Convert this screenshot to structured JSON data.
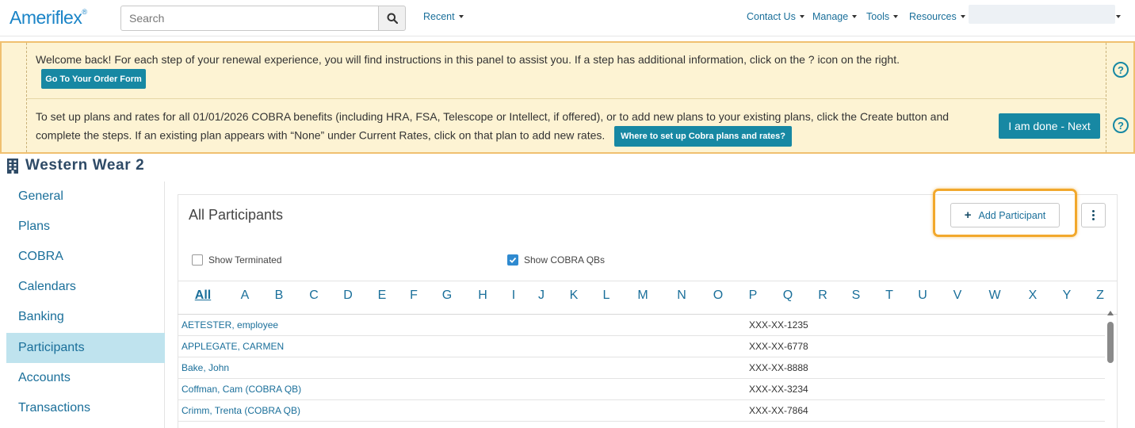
{
  "topnav": {
    "logo": "Ameriflex",
    "logo_mark": "®",
    "search_placeholder": "Search",
    "recent": "Recent",
    "contact_us": "Contact Us",
    "manage": "Manage",
    "tools": "Tools",
    "resources": "Resources"
  },
  "banner": {
    "welcome": "Welcome back! For each step of your renewal experience, you will find instructions in this panel to assist you. If a step has additional information, click on the ? icon on the right.",
    "order_button": "Go To Your Order Form",
    "instructions": "To set up plans and rates for all 01/01/2026 COBRA benefits (including HRA, FSA, Telescope or Intellect, if offered), or to add new plans to your existing plans, click the Create button and complete the steps. If an existing plan appears with “None” under Current Rates, click on that plan to add new rates.",
    "cobra_button": "Where to set up Cobra plans and rates?",
    "done_button": "I am done - Next",
    "help_glyph": "?"
  },
  "company": {
    "name": "Western Wear 2"
  },
  "sidebar": {
    "items": [
      {
        "label": "General"
      },
      {
        "label": "Plans"
      },
      {
        "label": "COBRA"
      },
      {
        "label": "Calendars"
      },
      {
        "label": "Banking"
      },
      {
        "label": "Participants",
        "active": true
      },
      {
        "label": "Accounts"
      },
      {
        "label": "Transactions"
      }
    ]
  },
  "main": {
    "title": "All Participants",
    "add_button": "Add Participant",
    "add_icon": "+",
    "show_terminated": "Show Terminated",
    "show_terminated_checked": false,
    "show_cobra": "Show COBRA QBs",
    "show_cobra_checked": true,
    "alphabet": [
      "All",
      "A",
      "B",
      "C",
      "D",
      "E",
      "F",
      "G",
      "H",
      "I",
      "J",
      "K",
      "L",
      "M",
      "N",
      "O",
      "P",
      "Q",
      "R",
      "S",
      "T",
      "U",
      "V",
      "W",
      "X",
      "Y",
      "Z"
    ],
    "selected_letter": "All",
    "rows": [
      {
        "name": "AETESTER, employee",
        "ssn": "XXX-XX-1235"
      },
      {
        "name": "APPLEGATE, CARMEN",
        "ssn": "XXX-XX-6778"
      },
      {
        "name": "Bake, John",
        "ssn": "XXX-XX-8888"
      },
      {
        "name": "Coffman, Cam (COBRA QB)",
        "ssn": "XXX-XX-3234"
      },
      {
        "name": "Crimm, Trenta (COBRA QB)",
        "ssn": "XXX-XX-7864"
      }
    ]
  },
  "colors": {
    "brand": "#1a84c7",
    "teal_button": "#1788a3",
    "banner_bg": "#fdf3d3",
    "highlight": "#f2a82c",
    "active_nav": "#bfe3ee"
  }
}
